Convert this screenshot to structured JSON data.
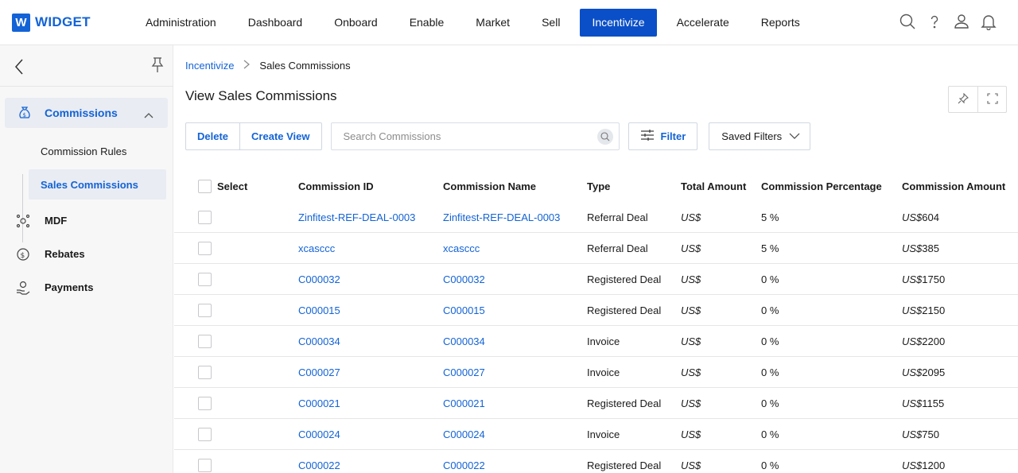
{
  "app": {
    "logo_letter": "W",
    "logo_text": "WIDGET",
    "brand_color": "#1363d6"
  },
  "nav": {
    "items": [
      {
        "label": "Administration"
      },
      {
        "label": "Dashboard"
      },
      {
        "label": "Onboard"
      },
      {
        "label": "Enable"
      },
      {
        "label": "Market"
      },
      {
        "label": "Sell"
      },
      {
        "label": "Incentivize",
        "active": true
      },
      {
        "label": "Accelerate"
      },
      {
        "label": "Reports"
      }
    ],
    "icons": [
      "search-icon",
      "help-icon",
      "user-icon",
      "notification-bell-icon"
    ]
  },
  "sidebar": {
    "group": {
      "label": "Commissions",
      "icon": "money-bag-icon",
      "expanded": true
    },
    "sub_items": [
      {
        "label": "Commission Rules"
      },
      {
        "label": "Sales Commissions",
        "active": true
      }
    ],
    "items": [
      {
        "label": "MDF",
        "icon": "mdf-icon"
      },
      {
        "label": "Rebates",
        "icon": "rebates-icon"
      },
      {
        "label": "Payments",
        "icon": "payments-icon"
      }
    ]
  },
  "breadcrumb": {
    "parent": "Incentivize",
    "current": "Sales Commissions"
  },
  "page": {
    "title": "View Sales Commissions"
  },
  "toolbar": {
    "delete_label": "Delete",
    "create_view_label": "Create View",
    "search_placeholder": "Search Commissions",
    "filter_label": "Filter",
    "saved_filters_label": "Saved Filters"
  },
  "table": {
    "columns": {
      "select": "Select",
      "id": "Commission ID",
      "name": "Commission Name",
      "type": "Type",
      "total": "Total Amount",
      "pct": "Commission Percentage",
      "amt": "Commission Amount"
    },
    "rows": [
      {
        "id": "Zinfitest-REF-DEAL-0003",
        "name": "Zinfitest-REF-DEAL-0003",
        "type": "Referral Deal",
        "total": "US$",
        "pct": "5 %",
        "cur": "US$",
        "amt": "604"
      },
      {
        "id": "xcasccc",
        "name": "xcasccc",
        "type": "Referral Deal",
        "total": "US$",
        "pct": "5 %",
        "cur": "US$",
        "amt": "385"
      },
      {
        "id": "C000032",
        "name": "C000032",
        "type": "Registered Deal",
        "total": "US$",
        "pct": "0 %",
        "cur": "US$",
        "amt": "1750"
      },
      {
        "id": "C000015",
        "name": "C000015",
        "type": "Registered Deal",
        "total": "US$",
        "pct": "0 %",
        "cur": "US$",
        "amt": "2150"
      },
      {
        "id": "C000034",
        "name": "C000034",
        "type": "Invoice",
        "total": "US$",
        "pct": "0 %",
        "cur": "US$",
        "amt": "2200"
      },
      {
        "id": "C000027",
        "name": "C000027",
        "type": "Invoice",
        "total": "US$",
        "pct": "0 %",
        "cur": "US$",
        "amt": "2095"
      },
      {
        "id": "C000021",
        "name": "C000021",
        "type": "Registered Deal",
        "total": "US$",
        "pct": "0 %",
        "cur": "US$",
        "amt": "1155"
      },
      {
        "id": "C000024",
        "name": "C000024",
        "type": "Invoice",
        "total": "US$",
        "pct": "0 %",
        "cur": "US$",
        "amt": "750"
      },
      {
        "id": "C000022",
        "name": "C000022",
        "type": "Registered Deal",
        "total": "US$",
        "pct": "0 %",
        "cur": "US$",
        "amt": "1200"
      }
    ]
  }
}
